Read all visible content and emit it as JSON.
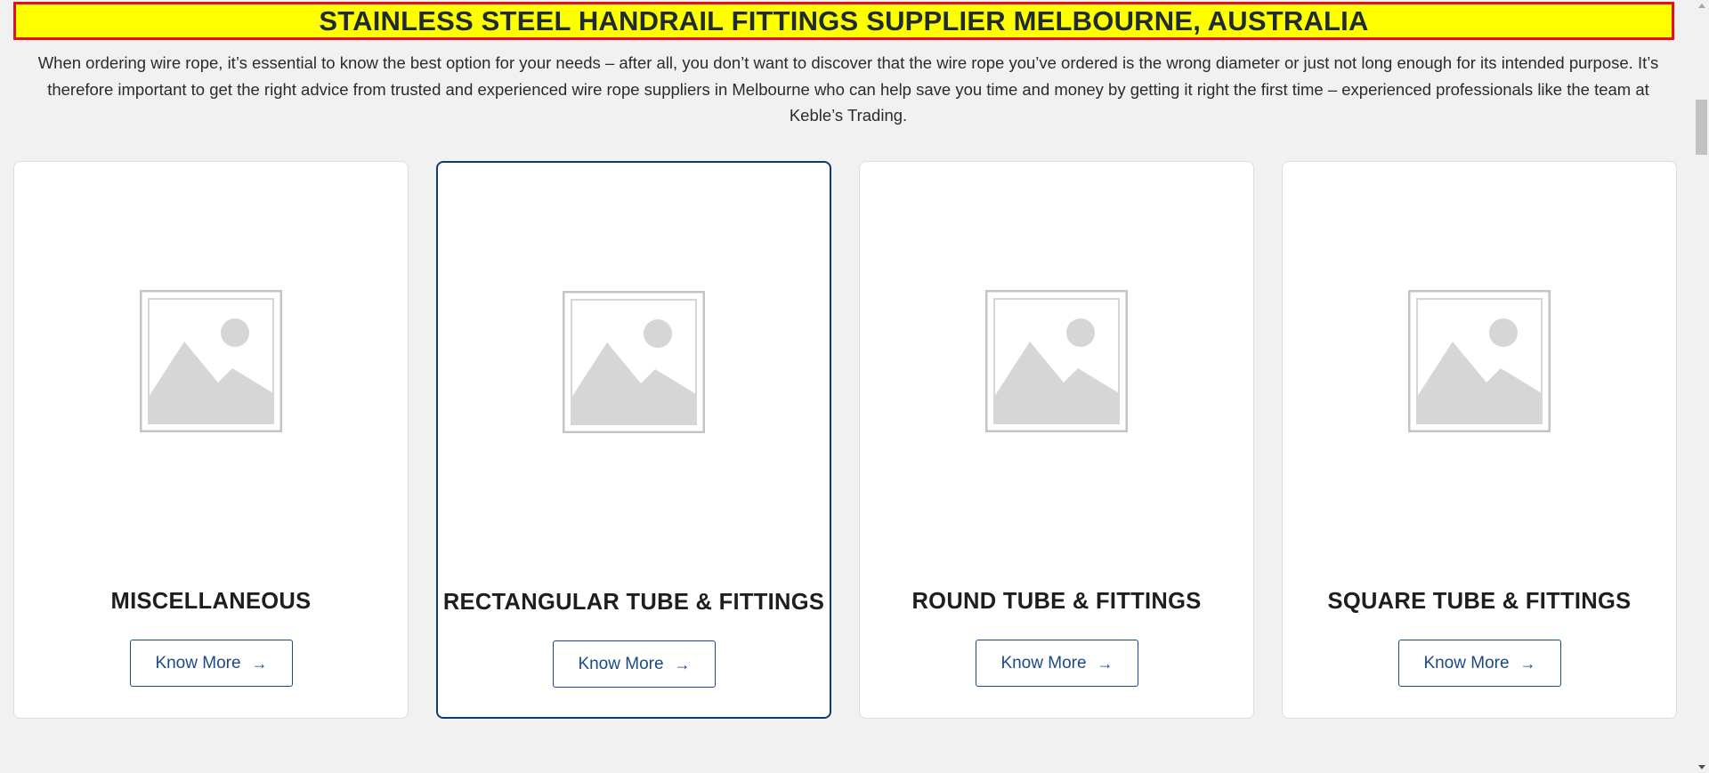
{
  "banner": {
    "title": "STAINLESS STEEL HANDRAIL FITTINGS SUPPLIER MELBOURNE, AUSTRALIA"
  },
  "intro": {
    "text": "When ordering wire rope, it’s essential to know the best option for your needs – after all, you don’t want to discover that the wire rope you’ve ordered is the wrong diameter or just not long enough for its intended purpose. It’s therefore important to get the right advice from trusted and experienced wire rope suppliers in Melbourne who can help save you time and money by getting it right the first time – experienced professionals like the team at Keble’s Trading."
  },
  "categories": [
    {
      "title": "MISCELLANEOUS",
      "button_label": "Know More",
      "button_icon": "arrow-right-icon",
      "image_icon": "image-placeholder-icon"
    },
    {
      "title": "RECTANGULAR TUBE & FITTINGS",
      "button_label": "Know More",
      "button_icon": "arrow-right-icon",
      "image_icon": "image-placeholder-icon"
    },
    {
      "title": "ROUND TUBE & FITTINGS",
      "button_label": "Know More",
      "button_icon": "arrow-right-icon",
      "image_icon": "image-placeholder-icon"
    },
    {
      "title": "SQUARE TUBE & FITTINGS",
      "button_label": "Know More",
      "button_icon": "arrow-right-icon",
      "image_icon": "image-placeholder-icon"
    }
  ],
  "colors": {
    "banner_bg": "#ffff00",
    "banner_border": "#e0101c",
    "button_accent": "#1a4a86",
    "active_card_border": "#0b3d6e",
    "page_bg": "#f1f1f1"
  }
}
